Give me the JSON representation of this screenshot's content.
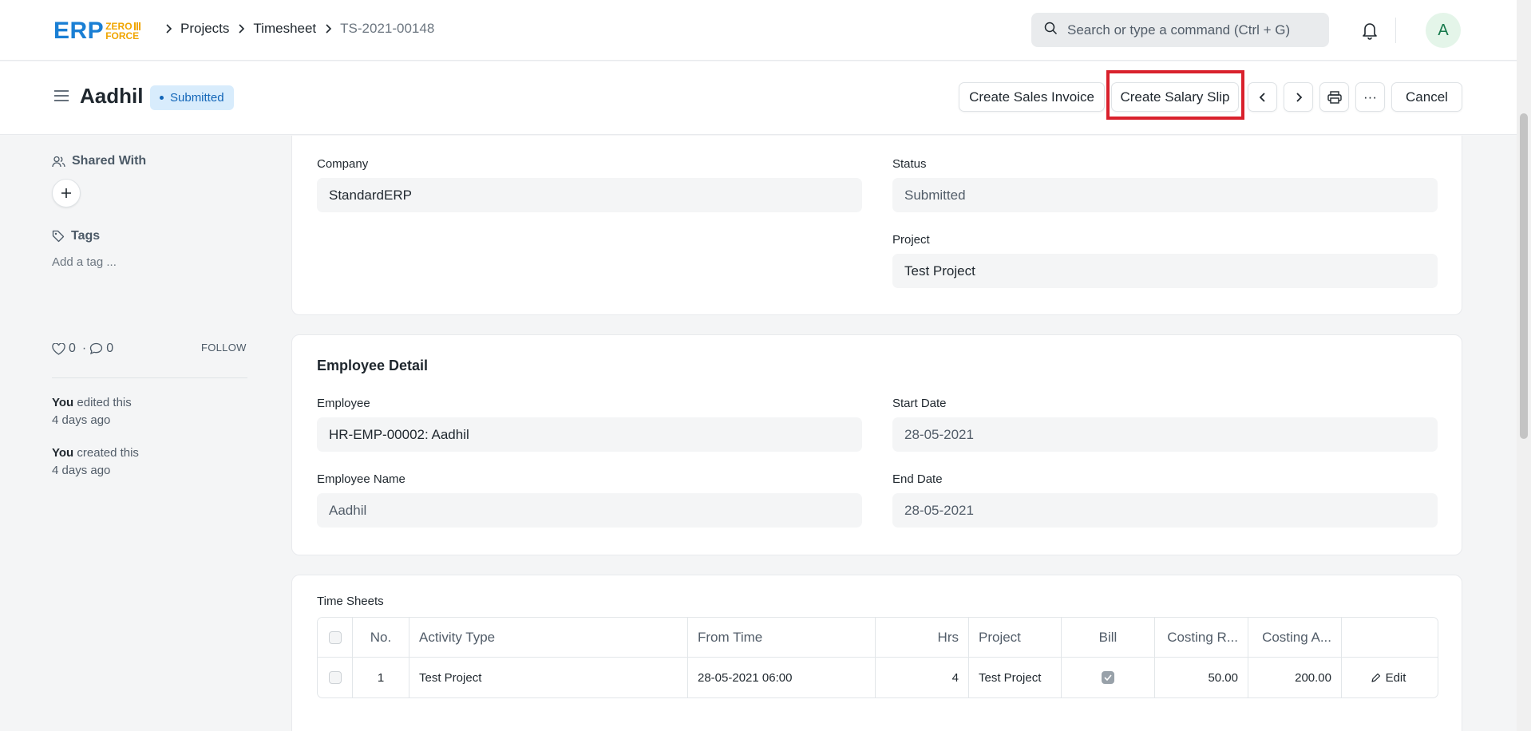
{
  "logo": {
    "main": "ERP",
    "top": "ZERO",
    "bottom": "FORCE"
  },
  "breadcrumb": {
    "items": [
      "Projects",
      "Timesheet"
    ],
    "current": "TS-2021-00148"
  },
  "search": {
    "placeholder": "Search or type a command (Ctrl + G)"
  },
  "user": {
    "avatar_initial": "A"
  },
  "header": {
    "title": "Aadhil",
    "status": "Submitted",
    "buttons": {
      "create_sales_invoice": "Create Sales Invoice",
      "create_salary_slip": "Create Salary Slip",
      "more": "···",
      "cancel": "Cancel"
    }
  },
  "sidebar": {
    "shared_with": "Shared With",
    "tags": "Tags",
    "add_tag": "Add a tag ...",
    "likes": "0",
    "comments": "0",
    "separator": "·",
    "follow": "FOLLOW",
    "activity": [
      {
        "who": "You",
        "action": "edited this",
        "when": "4 days ago"
      },
      {
        "who": "You",
        "action": "created this",
        "when": "4 days ago"
      }
    ]
  },
  "details": {
    "company_label": "Company",
    "company_value": "StandardERP",
    "status_label": "Status",
    "status_value": "Submitted",
    "project_label": "Project",
    "project_value": "Test Project"
  },
  "employee": {
    "section_title": "Employee Detail",
    "employee_label": "Employee",
    "employee_value": "HR-EMP-00002: Aadhil",
    "start_date_label": "Start Date",
    "start_date_value": "28-05-2021",
    "employee_name_label": "Employee Name",
    "employee_name_value": "Aadhil",
    "end_date_label": "End Date",
    "end_date_value": "28-05-2021"
  },
  "time_sheets": {
    "label": "Time Sheets",
    "columns": [
      "No.",
      "Activity Type",
      "From Time",
      "Hrs",
      "Project",
      "Bill",
      "Costing R...",
      "Costing A..."
    ],
    "rows": [
      {
        "no": "1",
        "activity_type": "Test Project",
        "from_time": "28-05-2021 06:00",
        "hrs": "4",
        "project": "Test Project",
        "bill": true,
        "costing_rate": "50.00",
        "costing_amount": "200.00",
        "edit": "Edit"
      }
    ]
  },
  "colors": {
    "accent_blue": "#1a7fd4",
    "logo_orange": "#f0a500",
    "status_bg": "#d8ecfc",
    "status_text": "#1366b8",
    "highlight_red": "#d9212c"
  }
}
